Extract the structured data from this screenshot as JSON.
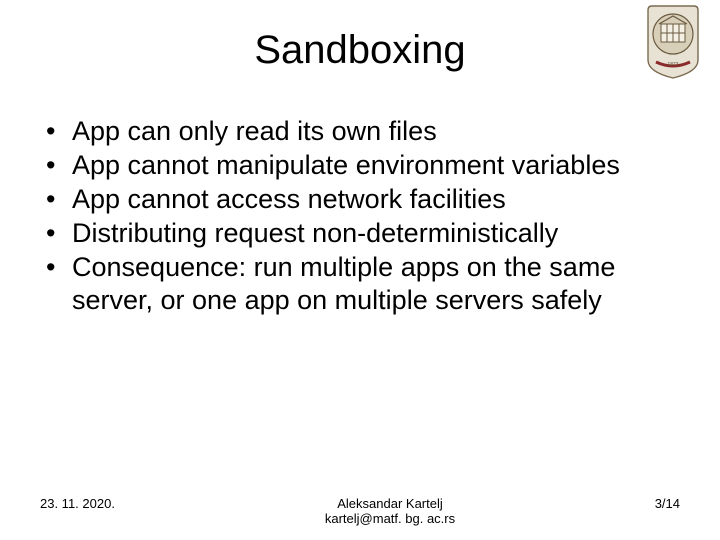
{
  "title": "Sandboxing",
  "bullets": [
    "App can only read its own files",
    "App cannot manipulate environment variables",
    "App cannot access network facilities",
    "Distributing request non-deterministically",
    "Consequence: run multiple apps on the same server, or one app on multiple servers safely"
  ],
  "footer": {
    "date": "23. 11. 2020.",
    "author": "Aleksandar Kartelj",
    "email": "kartelj@matf. bg. ac.rs",
    "page": "3/14"
  }
}
